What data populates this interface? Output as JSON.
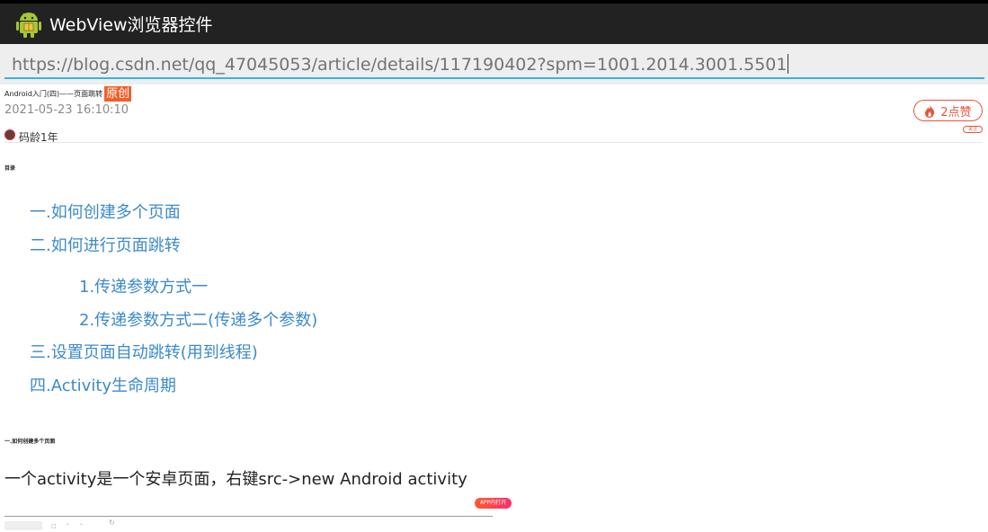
{
  "app": {
    "title": "WebView浏览器控件",
    "icon": "android-icon"
  },
  "address_bar": {
    "url": "https://blog.csdn.net/qq_47045053/article/details/117190402?spm=1001.2014.3001.5501"
  },
  "article": {
    "title": "Android入门(四)——页面跳转",
    "original_badge": "原创",
    "date": "2021-05-23 16:10:10",
    "code_age": "码龄1年",
    "like_label": "2点赞",
    "follow_label": "关注"
  },
  "toc": {
    "heading": "目录",
    "items": [
      "一.如何创建多个页面",
      "二.如何进行页面跳转",
      "1.传递参数方式一",
      "2.传递参数方式二(传递多个参数)",
      "三.设置页面自动跳转(用到线程)",
      "四.Activity生命周期"
    ]
  },
  "body": {
    "section_heading": "一.如何创建多个页面",
    "paragraph": "一个activity是一个安卓页面，右键src->new Android activity",
    "app_open_button": "APP内打开"
  },
  "colors": {
    "action_bar": "#222222",
    "url_underline": "#33b5e5",
    "link": "#3c8ac9",
    "badge": "#f35e28",
    "like": "#e8543a"
  }
}
